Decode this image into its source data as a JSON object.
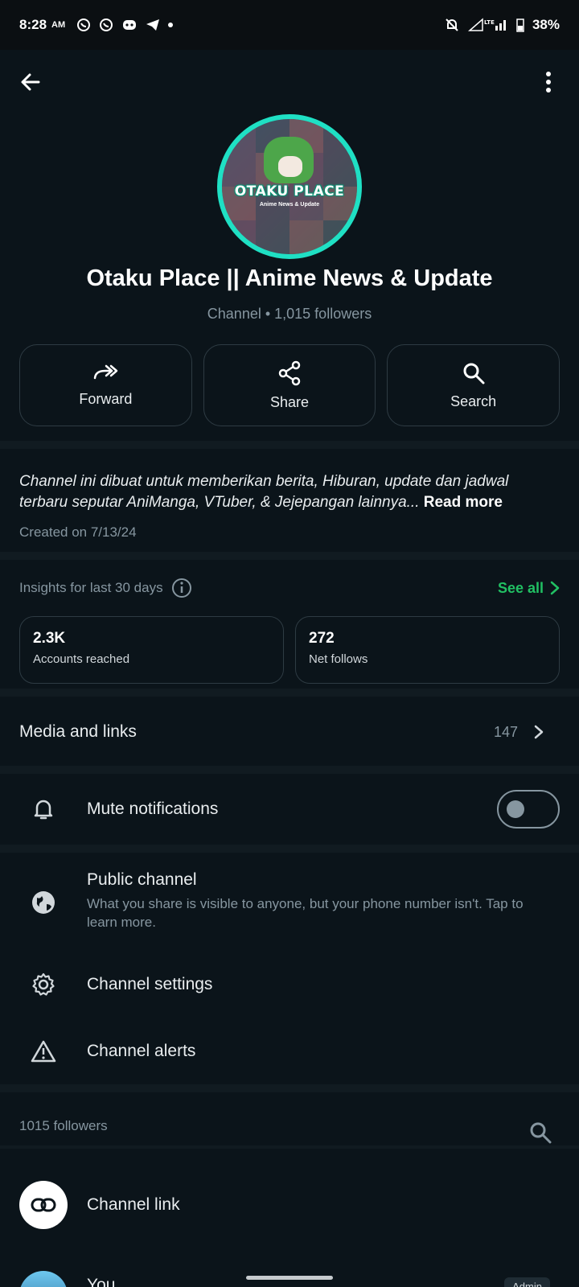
{
  "status_bar": {
    "time": "8:28",
    "ampm": "AM",
    "battery": "38%",
    "network": "LTE"
  },
  "channel": {
    "name": "Otaku Place || Anime News & Update",
    "meta": "Channel • 1,015 followers",
    "logo_text": "OTAKU PLACE",
    "logo_sub": "Anime News & Update"
  },
  "actions": {
    "forward": "Forward",
    "share": "Share",
    "search": "Search"
  },
  "description": {
    "text": "Channel ini dibuat untuk memberikan berita, Hiburan, update dan jadwal terbaru seputar AniManga, VTuber, & Jejepangan lainnya...",
    "read_more": "Read more",
    "created": "Created on 7/13/24"
  },
  "insights": {
    "title": "Insights for last 30 days",
    "see_all": "See all",
    "stats": [
      {
        "value": "2.3K",
        "label": "Accounts reached"
      },
      {
        "value": "272",
        "label": "Net follows"
      }
    ]
  },
  "media": {
    "title": "Media and links",
    "count": "147"
  },
  "mute": {
    "title": "Mute notifications",
    "enabled": false
  },
  "public_channel": {
    "title": "Public channel",
    "subtitle": "What you share is visible to anyone, but your phone number isn't. Tap to learn more."
  },
  "settings": {
    "channel_settings": "Channel settings",
    "channel_alerts": "Channel alerts"
  },
  "followers": {
    "header": "1015 followers",
    "channel_link": "Channel link",
    "you": "You",
    "admin_badge": "Admin"
  },
  "colors": {
    "background": "#0b141a",
    "accent_green": "#21c063",
    "avatar_ring": "#1fe0c4",
    "secondary_text": "#8696a0"
  }
}
